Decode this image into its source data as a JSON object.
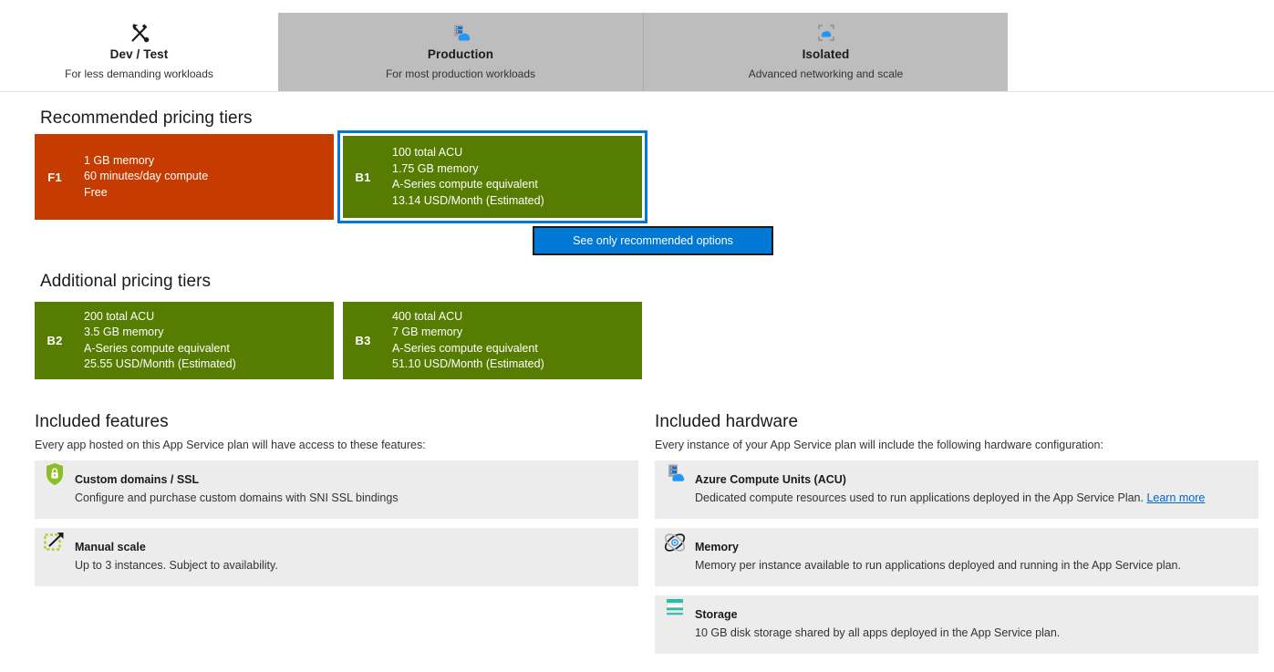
{
  "tabs": [
    {
      "id": "dev-test",
      "label": "Dev / Test",
      "subtitle": "For less demanding workloads",
      "icon": "tools-icon",
      "active": true
    },
    {
      "id": "production",
      "label": "Production",
      "subtitle": "For most production workloads",
      "icon": "server-cloud-icon",
      "active": false
    },
    {
      "id": "isolated",
      "label": "Isolated",
      "subtitle": "Advanced networking and scale",
      "icon": "cloud-in-frame-icon",
      "active": false
    }
  ],
  "recommended": {
    "heading": "Recommended pricing tiers",
    "tiers": [
      {
        "code": "F1",
        "color": "#c63b00",
        "selected": false,
        "lines": [
          "1 GB memory",
          "60 minutes/day compute",
          "Free"
        ]
      },
      {
        "code": "B1",
        "color": "#567c02",
        "selected": true,
        "lines": [
          "100 total ACU",
          "1.75 GB memory",
          "A-Series compute equivalent",
          "13.14 USD/Month (Estimated)"
        ]
      }
    ]
  },
  "reco_button": {
    "label": "See only recommended options",
    "background": "#0078d4"
  },
  "additional": {
    "heading": "Additional pricing tiers",
    "tiers": [
      {
        "code": "B2",
        "color": "#567c02",
        "selected": false,
        "lines": [
          "200 total ACU",
          "3.5 GB memory",
          "A-Series compute equivalent",
          "25.55 USD/Month (Estimated)"
        ]
      },
      {
        "code": "B3",
        "color": "#567c02",
        "selected": false,
        "lines": [
          "400 total ACU",
          "7 GB memory",
          "A-Series compute equivalent",
          "51.10 USD/Month (Estimated)"
        ]
      }
    ]
  },
  "features": {
    "heading": "Included features",
    "subtitle": "Every app hosted on this App Service plan will have access to these features:",
    "items": [
      {
        "icon": "shield-lock-icon",
        "title": "Custom domains / SSL",
        "description": "Configure and purchase custom domains with SNI SSL bindings",
        "link": ""
      },
      {
        "icon": "scale-arrow-icon",
        "title": "Manual scale",
        "description": "Up to 3 instances. Subject to availability.",
        "link": ""
      }
    ]
  },
  "hardware": {
    "heading": "Included hardware",
    "subtitle": "Every instance of your App Service plan will include the following hardware configuration:",
    "items": [
      {
        "icon": "server-cloud-icon",
        "title": "Azure Compute Units (ACU)",
        "description": "Dedicated compute resources used to run applications deployed in the App Service Plan.",
        "link": "Learn more"
      },
      {
        "icon": "memory-atom-icon",
        "title": "Memory",
        "description": "Memory per instance available to run applications deployed and running in the App Service plan.",
        "link": ""
      },
      {
        "icon": "storage-icon",
        "title": "Storage",
        "description": "10 GB disk storage shared by all apps deployed in the App Service plan.",
        "link": ""
      }
    ]
  }
}
